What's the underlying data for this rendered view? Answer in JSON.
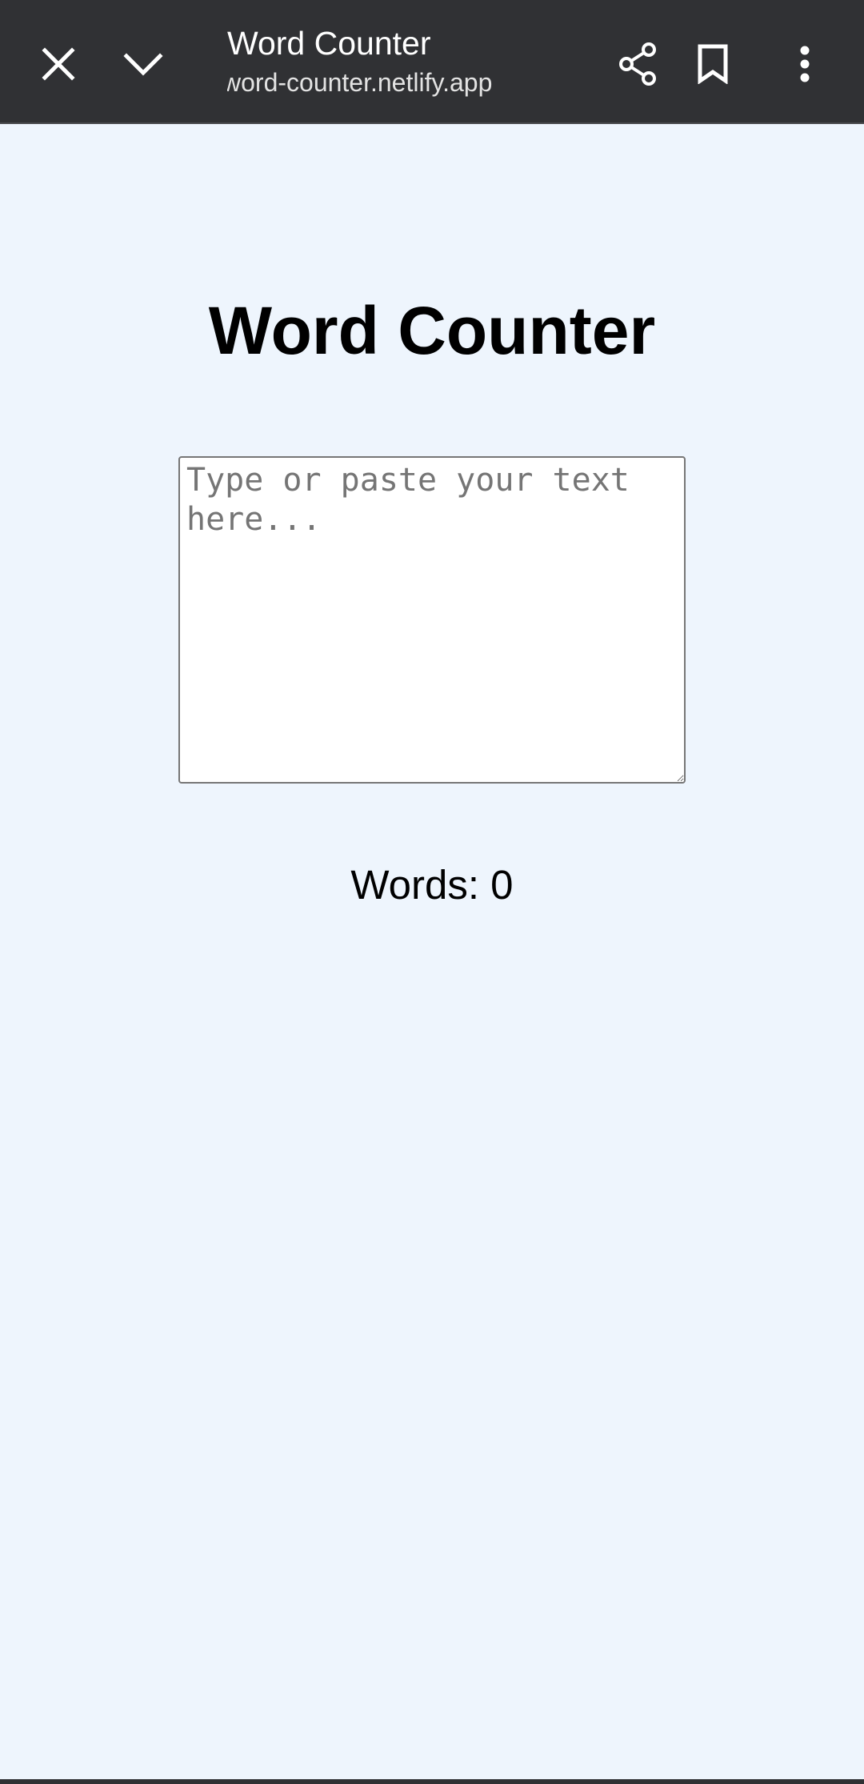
{
  "browser": {
    "tab_title": "Word Counter",
    "url": "word-counter.netlify.app",
    "icons": {
      "close": "close-icon",
      "minimize": "chevron-down-icon",
      "share": "share-icon",
      "bookmark": "bookmark-icon",
      "menu": "more-vert-icon"
    },
    "toolbar_color": "#303134"
  },
  "page": {
    "heading": "Word Counter",
    "textarea": {
      "value": "",
      "placeholder": "Type or paste your text here..."
    },
    "word_count_label": "Words: 0",
    "background_color": "#eef5fd"
  }
}
